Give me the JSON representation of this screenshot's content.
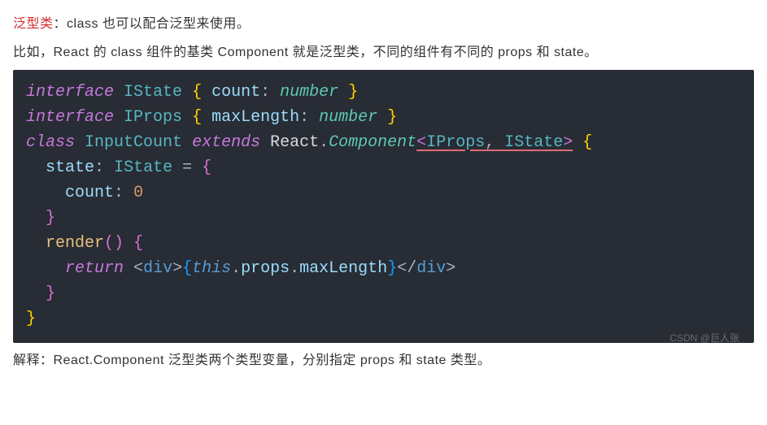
{
  "para1": {
    "highlight": "泛型类",
    "rest": "：class 也可以配合泛型来使用。"
  },
  "para2": "比如，React 的 class 组件的基类 Component 就是泛型类，不同的组件有不同的 props 和 state。",
  "code": {
    "l1": {
      "kw1": "interface",
      "name": "IState",
      "lbrace": "{",
      "prop": "count",
      "colon": ":",
      "type": "number",
      "rbrace": "}"
    },
    "l2": {
      "kw1": "interface",
      "name": "IProps",
      "lbrace": "{",
      "prop": "maxLength",
      "colon": ":",
      "type": "number",
      "rbrace": "}"
    },
    "l3": {
      "kw1": "class",
      "name": "InputCount",
      "kw2": "extends",
      "react": "React",
      "dot": ".",
      "comp": "Component",
      "lt": "<",
      "t1": "IProps",
      "comma": ",",
      "t2": "IState",
      "gt": ">",
      "lbrace": "{"
    },
    "l4": {
      "indent": "  ",
      "prop": "state",
      "colon": ":",
      "type": "IState",
      "eq": "=",
      "lbrace": "{"
    },
    "l5": {
      "indent": "    ",
      "prop": "count",
      "colon": ":",
      "val": "0"
    },
    "l6": {
      "indent": "  ",
      "rbrace": "}"
    },
    "l7": {
      "indent": "  ",
      "fn": "render",
      "parens": "()",
      "lbrace": "{"
    },
    "l8": {
      "indent": "    ",
      "kw": "return",
      "lt1": "<",
      "tag1": "div",
      "gt1": ">",
      "lb": "{",
      "this": "this",
      "d1": ".",
      "p1": "props",
      "d2": ".",
      "p2": "maxLength",
      "rb": "}",
      "lt2": "</",
      "tag2": "div",
      "gt2": ">"
    },
    "l9": {
      "indent": "  ",
      "rbrace": "}"
    },
    "l10": {
      "rbrace": "}"
    }
  },
  "para3": "解释：React.Component 泛型类两个类型变量，分别指定 props 和 state 类型。",
  "watermark": "CSDN @巨人张"
}
